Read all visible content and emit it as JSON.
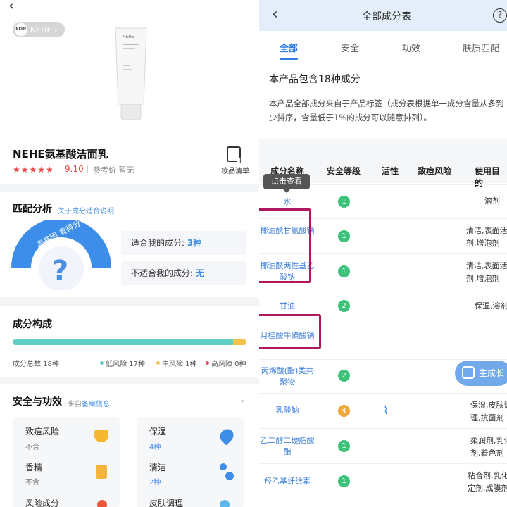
{
  "left": {
    "brand_pill": "NEHE",
    "brand_logo_text": "NEHE",
    "product_label": "NEHE",
    "product_name": "NEHE氨基酸洁面乳",
    "stars": "★★★★★",
    "score": "9.10",
    "ref_price": "参考价 暂无",
    "list_label": "妆品清单",
    "match": {
      "title": "匹配分析",
      "link": "关于成分适合说明",
      "gauge_text": "测基因·看得分",
      "gauge_symbol": "?",
      "suitable_label": "适合我的成分:",
      "suitable_value": "3种",
      "unsuitable_label": "不适合我的成分:",
      "unsuitable_value": "无"
    },
    "composition": {
      "title": "成分构成",
      "total": "成分总数 18种",
      "low_risk": "低风险 17种",
      "mid_risk": "中风险 1种",
      "high_risk": "高风险 0种",
      "low_fraction": 0.944,
      "mid_fraction": 0.056,
      "colors": {
        "low": "#5fcfc4",
        "mid": "#f2c14e",
        "high": "#e84a6a"
      }
    },
    "safety": {
      "title": "安全与功效",
      "note_prefix": "来自",
      "note_link": "备案信息",
      "items": [
        {
          "label": "致痘风险",
          "sub": "不含",
          "icon": "acne-icon"
        },
        {
          "label": "保湿",
          "sub": "4种",
          "icon": "water-drop-icon"
        },
        {
          "label": "香精",
          "sub": "不含",
          "icon": "perfume-icon"
        },
        {
          "label": "清洁",
          "sub": "2种",
          "icon": "bubbles-icon"
        },
        {
          "label": "风险成分",
          "sub": "",
          "icon": "risk-icon"
        },
        {
          "label": "皮肤调理",
          "sub": "",
          "icon": "skin-care-icon"
        }
      ]
    }
  },
  "right": {
    "header_title": "全部成分表",
    "help": "?",
    "tabs": [
      "全部",
      "安全",
      "功效",
      "肤质匹配"
    ],
    "count_text": "本产品包含18种成分",
    "description": "本产品全部成分来自于产品标签（成分表根据单一成分含量从多到少排序，含量低于1%的成分可以随意排列）。",
    "columns": [
      "成分名称",
      "安全等级",
      "活性",
      "致痘风险",
      "使用目的"
    ],
    "tooltip": "点击查看",
    "rows": [
      {
        "name": "水",
        "level": "1",
        "active": "",
        "use": "溶剂"
      },
      {
        "name": "椰油酰甘氨酸钠",
        "level": "1",
        "active": "",
        "use": "清洁,表面活\n剂,增泡剂"
      },
      {
        "name": "椰油酰两性基乙酸钠",
        "level": "1",
        "active": "",
        "use": "清洁,表面活\n剂,增泡剂"
      },
      {
        "name": "甘油",
        "level": "2",
        "active": "",
        "use": "保湿,溶剂"
      },
      {
        "name": "月桂酸牛磺酸钠",
        "level": "",
        "active": "",
        "use": ""
      },
      {
        "name": "丙烯酸(酯)类共聚物",
        "level": "2",
        "active": "",
        "use": ""
      },
      {
        "name": "乳酸钠",
        "level": "4",
        "active": "dna-icon",
        "use": "保湿,皮肤调\n理,抗菌剂"
      },
      {
        "name": "乙二醇二硬脂酸酯",
        "level": "1",
        "active": "",
        "use": "柔润剂,乳化\n剂,着色剂"
      },
      {
        "name": "羟乙基纤维素",
        "level": "1",
        "active": "",
        "use": "粘合剂,乳化\n定剂,成膜剂"
      }
    ],
    "generate_button": "生成长图"
  }
}
